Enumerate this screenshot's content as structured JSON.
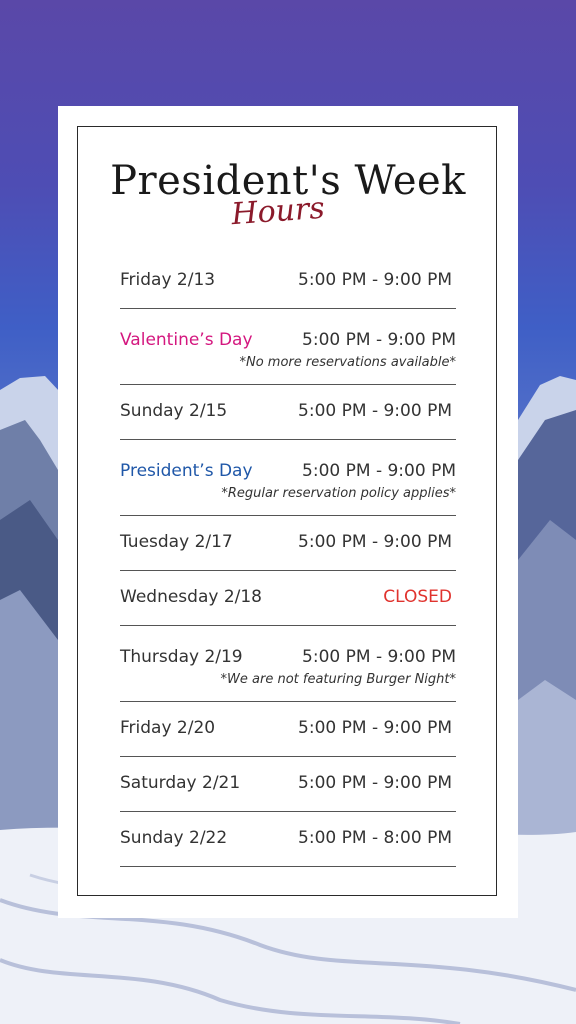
{
  "colors": {
    "valentine": "#d4177f",
    "presidents": "#1f57a8",
    "closed": "#e0332e",
    "subtitle": "#8b1a2b"
  },
  "header": {
    "title": "President's Week",
    "subtitle": "Hours"
  },
  "schedule": [
    {
      "day": "Friday 2/13",
      "time": "5:00 PM - 9:00 PM"
    },
    {
      "day": "Valentine’s Day",
      "time": "5:00 PM - 9:00 PM",
      "note": "*No more reservations available*"
    },
    {
      "day": "Sunday 2/15",
      "time": "5:00 PM - 9:00 PM"
    },
    {
      "day": "President’s Day",
      "time": "5:00 PM - 9:00 PM",
      "note": "*Regular reservation policy applies*"
    },
    {
      "day": "Tuesday 2/17",
      "time": "5:00 PM - 9:00 PM"
    },
    {
      "day": "Wednesday 2/18",
      "time": "CLOSED"
    },
    {
      "day": "Thursday 2/19",
      "time": "5:00 PM - 9:00 PM",
      "note": "*We are not featuring Burger Night*"
    },
    {
      "day": "Friday 2/20",
      "time": "5:00 PM - 9:00 PM"
    },
    {
      "day": "Saturday 2/21",
      "time": "5:00 PM - 9:00 PM"
    },
    {
      "day": "Sunday 2/22",
      "time": "5:00 PM - 8:00 PM"
    }
  ]
}
